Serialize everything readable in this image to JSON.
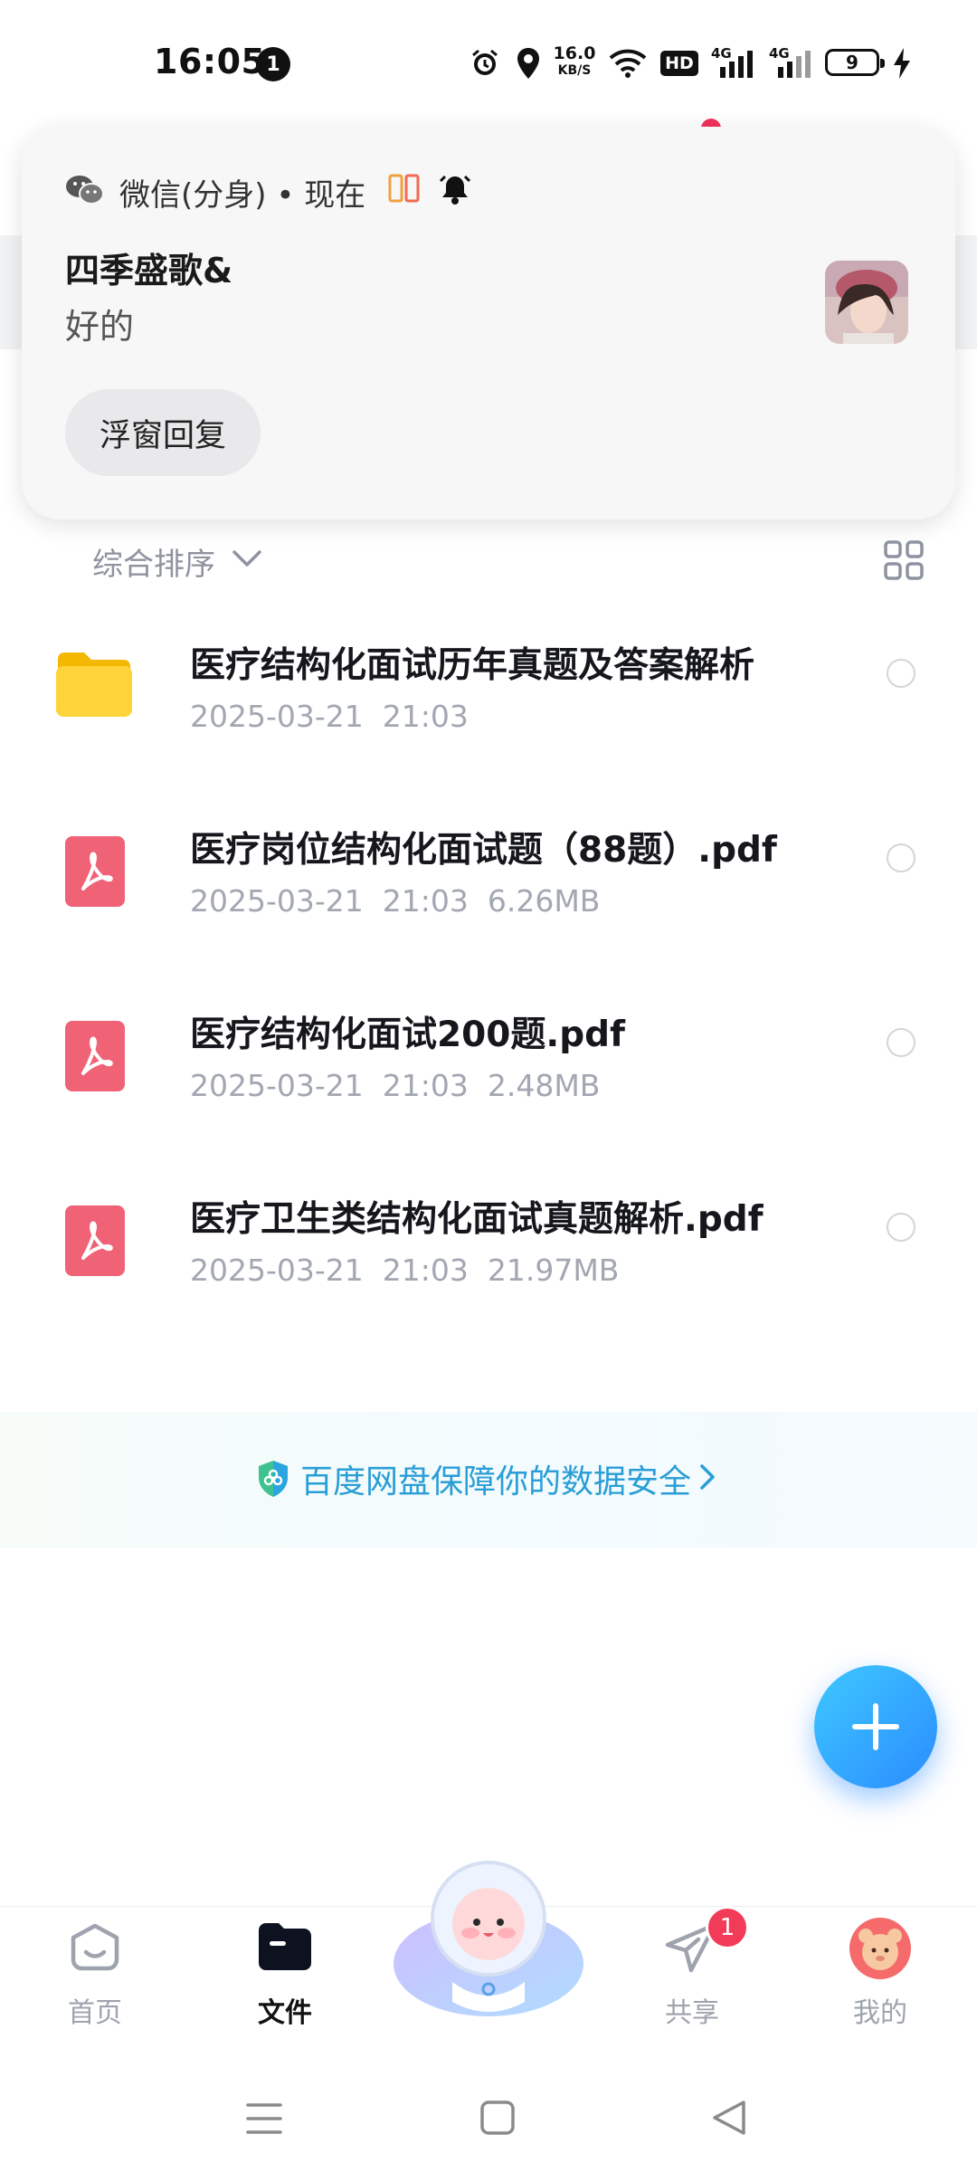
{
  "status_bar": {
    "time": "16:05",
    "notification_count": "1",
    "net_speed_value": "16.0",
    "net_speed_unit": "KB/S",
    "hd_label": "HD",
    "signal_1_label": "4G",
    "signal_2_label": "4G",
    "battery_level": "9"
  },
  "notification": {
    "app_name": "微信(分身) • 现在",
    "sender": "四季盛歌&",
    "message": "好的",
    "reply_button": "浮窗回复"
  },
  "toolbar": {
    "sort_label": "综合排序"
  },
  "files": [
    {
      "name": "医疗结构化面试历年真题及答案解析",
      "date": "2025-03-21",
      "time": "21:03",
      "size": "",
      "type": "folder"
    },
    {
      "name": "医疗岗位结构化面试题（88题）.pdf",
      "date": "2025-03-21",
      "time": "21:03",
      "size": "6.26MB",
      "type": "pdf"
    },
    {
      "name": "医疗结构化面试200题.pdf",
      "date": "2025-03-21",
      "time": "21:03",
      "size": "2.48MB",
      "type": "pdf"
    },
    {
      "name": "医疗卫生类结构化面试真题解析.pdf",
      "date": "2025-03-21",
      "time": "21:03",
      "size": "21.97MB",
      "type": "pdf"
    }
  ],
  "security_banner": {
    "text": "百度网盘保障你的数据安全"
  },
  "bottom_nav": {
    "home": "首页",
    "files": "文件",
    "share": "共享",
    "share_badge": "1",
    "me": "我的"
  },
  "colors": {
    "accent_blue": "#2b8cff",
    "pdf_red": "#f06275",
    "folder_yellow": "#ffcf33",
    "badge_red": "#f23b58",
    "security_text": "#2a9ed6"
  }
}
